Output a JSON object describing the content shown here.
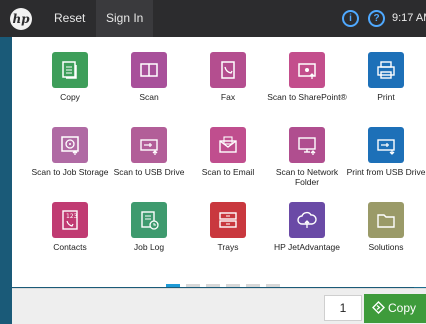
{
  "topbar": {
    "logo_text": "hp",
    "reset_label": "Reset",
    "signin_label": "Sign In",
    "info_icon": "i",
    "help_icon": "?",
    "time": "9:17 AM"
  },
  "tiles": [
    {
      "label": "Copy",
      "color": "#3e9e5a",
      "icon": "copy-icon"
    },
    {
      "label": "Scan",
      "color": "#a8509a",
      "icon": "scan-icon"
    },
    {
      "label": "Fax",
      "color": "#b44e8f",
      "icon": "fax-icon"
    },
    {
      "label": "Scan to SharePoint®",
      "color": "#c34e8c",
      "icon": "sharepoint-icon"
    },
    {
      "label": "Print",
      "color": "#1d70b8",
      "icon": "print-icon"
    },
    {
      "label": "Scan to Job Storage",
      "color": "#b06aa4",
      "icon": "job-storage-icon"
    },
    {
      "label": "Scan to USB Drive",
      "color": "#b25e98",
      "icon": "usb-icon"
    },
    {
      "label": "Scan to Email",
      "color": "#c04e8e",
      "icon": "email-icon"
    },
    {
      "label": "Scan to Network Folder",
      "color": "#b04e8f",
      "icon": "network-folder-icon"
    },
    {
      "label": "Print from USB Drive",
      "color": "#1d70b8",
      "icon": "print-usb-icon"
    },
    {
      "label": "Contacts",
      "color": "#c03b72",
      "icon": "contacts-icon"
    },
    {
      "label": "Job Log",
      "color": "#3e9a6e",
      "icon": "job-log-icon"
    },
    {
      "label": "Trays",
      "color": "#c9383e",
      "icon": "trays-icon"
    },
    {
      "label": "HP JetAdvantage",
      "color": "#6a4aa6",
      "icon": "cloud-icon"
    },
    {
      "label": "Solutions",
      "color": "#9a9a68",
      "icon": "folder-icon"
    }
  ],
  "pager": {
    "pages": 6,
    "active": 0
  },
  "bottombar": {
    "copies_value": "1",
    "copy_label": "Copy"
  }
}
